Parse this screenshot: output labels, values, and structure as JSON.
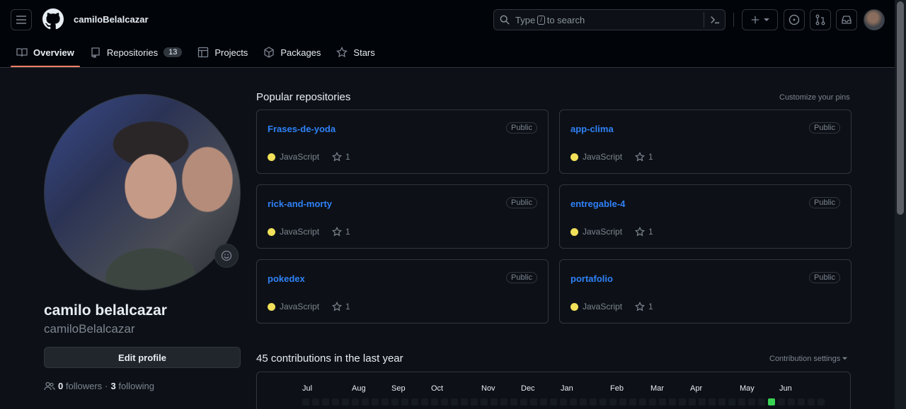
{
  "header": {
    "username": "camiloBelalcazar",
    "search": {
      "prefix": "Type",
      "key": "/",
      "suffix": "to search"
    }
  },
  "tabs": [
    {
      "label": "Overview",
      "icon": "book-icon",
      "active": true
    },
    {
      "label": "Repositories",
      "icon": "repo-icon",
      "count": "13"
    },
    {
      "label": "Projects",
      "icon": "table-icon"
    },
    {
      "label": "Packages",
      "icon": "package-icon"
    },
    {
      "label": "Stars",
      "icon": "star-icon"
    }
  ],
  "profile": {
    "name": "camilo belalcazar",
    "login": "camiloBelalcazar",
    "edit_label": "Edit profile",
    "followers_count": "0",
    "followers_label": "followers",
    "sep": "·",
    "following_count": "3",
    "following_label": "following"
  },
  "popular": {
    "title": "Popular repositories",
    "customize": "Customize your pins",
    "repos": [
      {
        "name": "Frases-de-yoda",
        "visibility": "Public",
        "language": "JavaScript",
        "stars": "1"
      },
      {
        "name": "app-clima",
        "visibility": "Public",
        "language": "JavaScript",
        "stars": "1"
      },
      {
        "name": "rick-and-morty",
        "visibility": "Public",
        "language": "JavaScript",
        "stars": "1"
      },
      {
        "name": "entregable-4",
        "visibility": "Public",
        "language": "JavaScript",
        "stars": "1"
      },
      {
        "name": "pokedex",
        "visibility": "Public",
        "language": "JavaScript",
        "stars": "1"
      },
      {
        "name": "portafolio",
        "visibility": "Public",
        "language": "JavaScript",
        "stars": "1"
      }
    ],
    "language_color": "#f1e05a"
  },
  "contributions": {
    "title": "45 contributions in the last year",
    "settings": "Contribution settings",
    "months": [
      "Jul",
      "Aug",
      "Sep",
      "Oct",
      "Nov",
      "Dec",
      "Jan",
      "Feb",
      "Mar",
      "Apr",
      "May",
      "Jun"
    ]
  },
  "colors": {
    "accent": "#f78166",
    "link": "#2f81f7",
    "bg": "#0d1117",
    "header_bg": "#010409"
  }
}
